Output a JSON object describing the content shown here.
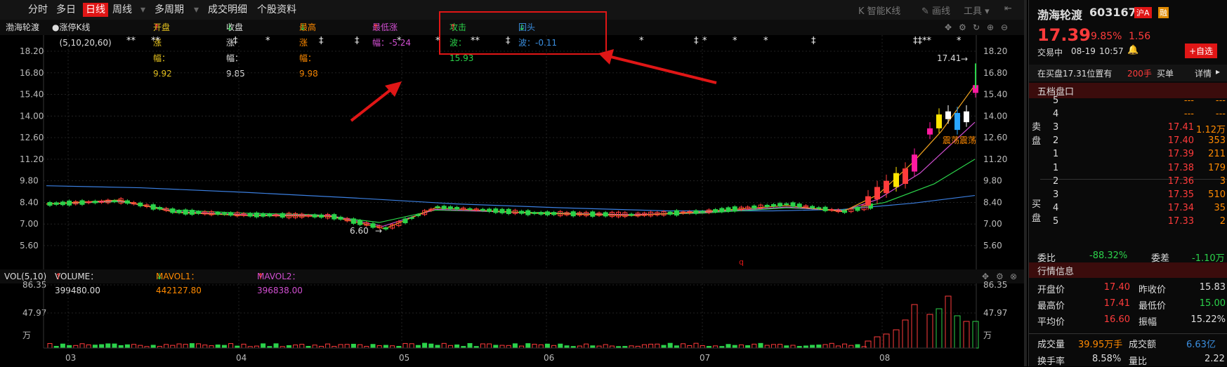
{
  "tabs": [
    "分时",
    "多日",
    "日线",
    "周线",
    "多周期",
    "成交明细",
    "个股资料"
  ],
  "toolbar": {
    "smart_k": "智能K线",
    "draw": "画线",
    "tools": "工具"
  },
  "info": {
    "name": "渤海轮渡",
    "kline": "涨停K线(5,10,20,60)",
    "open_rise": "开盘涨幅：9.92",
    "close_rise": "收盘涨幅：9.85",
    "high_rise": "最高涨幅：9.98",
    "low_rise": "最低涨幅：-5.24",
    "attack": "攻击波：15.93",
    "pullback": "回头波：-0.11"
  },
  "colors": {
    "up": "#ff3b3b",
    "down": "#2bd24a",
    "accent": "#e01616",
    "ma5": "#f0a21e",
    "ma10": "#d24fd2",
    "ma20": "#2bd24a",
    "ma60": "#3b7fe0"
  },
  "chart_data": {
    "type": "candlestick",
    "y_ticks": [
      "18.20",
      "16.80",
      "15.40",
      "14.00",
      "12.60",
      "11.20",
      "9.80",
      "8.40",
      "7.00",
      "5.60"
    ],
    "ylim": [
      5.6,
      18.2
    ],
    "x_ticks": [
      "03",
      "04",
      "05",
      "06",
      "07",
      "08"
    ],
    "annotations": {
      "high": "17.41",
      "low": "6.60",
      "text": "震荡震荡",
      "marker": "q"
    },
    "vol_ticks": [
      "86.35",
      "47.97",
      "万"
    ]
  },
  "vol": {
    "label": "VOL(5,10)",
    "volume": "VOLUME：399480.00",
    "mavol1": "MAVOL1：442127.80",
    "mavol2": "MAVOL2：396838.00"
  },
  "quote": {
    "name": "渤海轮渡",
    "code": "603167",
    "badge1": "沪A",
    "badge2": "融",
    "price": "17.39",
    "pct": "9.85%",
    "chg": "1.56",
    "status": "交易中",
    "date": "08-19",
    "time": "10:57",
    "add": "+自选",
    "notice": "在买盘17.31位置有",
    "notice_qty": "200手",
    "notice_suffix": "买单",
    "detail": "详情"
  },
  "book": {
    "title": "五档盘口",
    "sell_label": "卖盘",
    "buy_label": "买盘",
    "sells": [
      {
        "n": "5",
        "p": "---",
        "v": "---"
      },
      {
        "n": "4",
        "p": "---",
        "v": "---"
      },
      {
        "n": "3",
        "p": "17.41",
        "v": "1.12万"
      },
      {
        "n": "2",
        "p": "17.40",
        "v": "353"
      },
      {
        "n": "1",
        "p": "17.39",
        "v": "211"
      }
    ],
    "buys": [
      {
        "n": "1",
        "p": "17.38",
        "v": "179"
      },
      {
        "n": "2",
        "p": "17.36",
        "v": "3"
      },
      {
        "n": "3",
        "p": "17.35",
        "v": "510"
      },
      {
        "n": "4",
        "p": "17.34",
        "v": "35"
      },
      {
        "n": "5",
        "p": "17.33",
        "v": "2"
      }
    ],
    "weibi_l": "委比",
    "weibi": "-88.32%",
    "weicha_l": "委差",
    "weicha": "-1.10万"
  },
  "market": {
    "title": "行情信息",
    "rows": [
      {
        "l1": "开盘价",
        "v1": "17.40",
        "l2": "昨收价",
        "v2": "15.83"
      },
      {
        "l1": "最高价",
        "v1": "17.41",
        "l2": "最低价",
        "v2": "15.00"
      },
      {
        "l1": "平均价",
        "v1": "16.60",
        "l2": "振幅",
        "v2": "15.22%"
      }
    ],
    "vol_l": "成交量",
    "vol": "39.95万手",
    "amt_l": "成交额",
    "amt": "6.63亿",
    "turn_l": "换手率",
    "turn": "8.58%",
    "lb_l": "量比",
    "lb": "2.22"
  }
}
